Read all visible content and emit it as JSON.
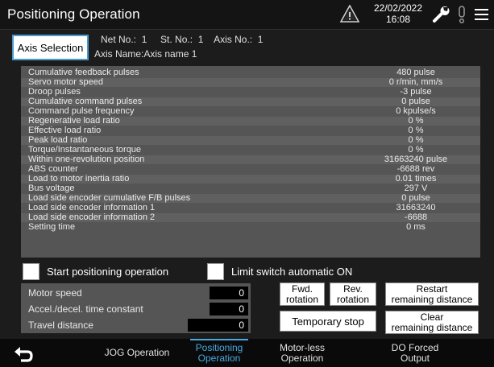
{
  "header": {
    "title": "Positioning Operation",
    "date": "22/02/2022",
    "time": "16:08",
    "icons": [
      "warning-icon",
      "wrench-icon",
      "alarm-icon",
      "menu-icon"
    ]
  },
  "axis": {
    "button_label": "Axis Selection",
    "net_no_label": "Net No.:",
    "net_no": "1",
    "st_no_label": "St. No.:",
    "st_no": "1",
    "axis_no_label": "Axis No.:",
    "axis_no": "1",
    "axis_name_label": "Axis Name:",
    "axis_name": "Axis name 1"
  },
  "monitor": [
    {
      "label": "Cumulative feedback pulses",
      "value": "480 pulse"
    },
    {
      "label": "Servo motor speed",
      "value": "0 r/min, mm/s"
    },
    {
      "label": "Droop pulses",
      "value": "-3 pulse"
    },
    {
      "label": "Cumulative command pulses",
      "value": "0 pulse"
    },
    {
      "label": "Command pulse frequency",
      "value": "0 kpulse/s"
    },
    {
      "label": "Regenerative load ratio",
      "value": "0 %"
    },
    {
      "label": "Effective load ratio",
      "value": "0 %"
    },
    {
      "label": "Peak load ratio",
      "value": "0 %"
    },
    {
      "label": "Torque/Instantaneous torque",
      "value": "0 %"
    },
    {
      "label": "Within one-revolution position",
      "value": "31663240 pulse"
    },
    {
      "label": "ABS counter",
      "value": "-6688 rev"
    },
    {
      "label": "Load to motor inertia ratio",
      "value": "0.01 times"
    },
    {
      "label": "Bus voltage",
      "value": "297 V"
    },
    {
      "label": "Load side encoder cumulative F/B pulses",
      "value": "0 pulse"
    },
    {
      "label": "Load side encoder information 1",
      "value": "31663240"
    },
    {
      "label": "Load side encoder information 2",
      "value": "-6688"
    },
    {
      "label": "Setting time",
      "value": "0 ms"
    }
  ],
  "options": {
    "start_positioning_label": "Start positioning operation",
    "limit_switch_label": "Limit switch automatic ON"
  },
  "params": {
    "motor_speed_label": "Motor speed",
    "motor_speed": "0",
    "accel_label": "Accel./decel. time constant",
    "accel": "0",
    "travel_label": "Travel distance",
    "travel": "0"
  },
  "buttons": {
    "fwd_line1": "Fwd.",
    "fwd_line2": "rotation",
    "rev_line1": "Rev.",
    "rev_line2": "rotation",
    "restart_line1": "Restart",
    "restart_line2": "remaining distance",
    "temp_stop": "Temporary stop",
    "clear_line1": "Clear",
    "clear_line2": "remaining distance"
  },
  "tabs": {
    "jog": "JOG Operation",
    "positioning_line1": "Positioning",
    "positioning_line2": "Operation",
    "motorless_line1": "Motor-less",
    "motorless_line2": "Operation",
    "do_forced_line1": "DO Forced",
    "do_forced_line2": "Output"
  },
  "colors": {
    "accent": "#4aa8e0",
    "panel": "#555555",
    "background": "#1c1c1c"
  }
}
